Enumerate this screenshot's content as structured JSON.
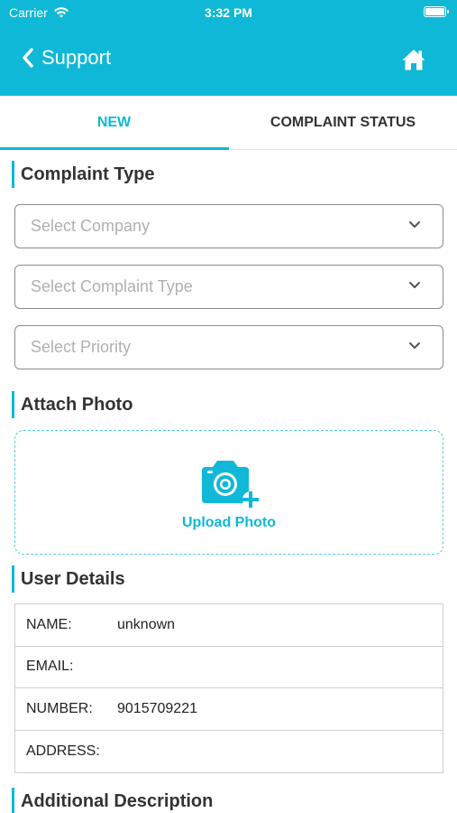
{
  "status_bar": {
    "carrier": "Carrier",
    "time": "3:32 PM"
  },
  "header": {
    "back_label": "Support"
  },
  "tabs": [
    {
      "label": "NEW",
      "active": true
    },
    {
      "label": "COMPLAINT STATUS",
      "active": false
    }
  ],
  "complaint_type": {
    "title": "Complaint Type",
    "selects": [
      {
        "placeholder": "Select Company"
      },
      {
        "placeholder": "Select Complaint Type"
      },
      {
        "placeholder": "Select Priority"
      }
    ]
  },
  "attach_photo": {
    "title": "Attach Photo",
    "upload_label": "Upload Photo"
  },
  "user_details": {
    "title": "User Details",
    "rows": [
      {
        "label": "NAME:",
        "value": "unknown"
      },
      {
        "label": "EMAIL:",
        "value": ""
      },
      {
        "label": "NUMBER:",
        "value": "9015709221"
      },
      {
        "label": "ADDRESS:",
        "value": ""
      }
    ]
  },
  "additional_description": {
    "title": "Additional Description"
  },
  "colors": {
    "accent": "#0fb8d6",
    "header_bg": "#0fb8d6"
  },
  "icons": [
    "wifi-icon",
    "battery-icon",
    "chevron-left-icon",
    "home-icon",
    "chevron-down-icon",
    "camera-add-icon"
  ]
}
